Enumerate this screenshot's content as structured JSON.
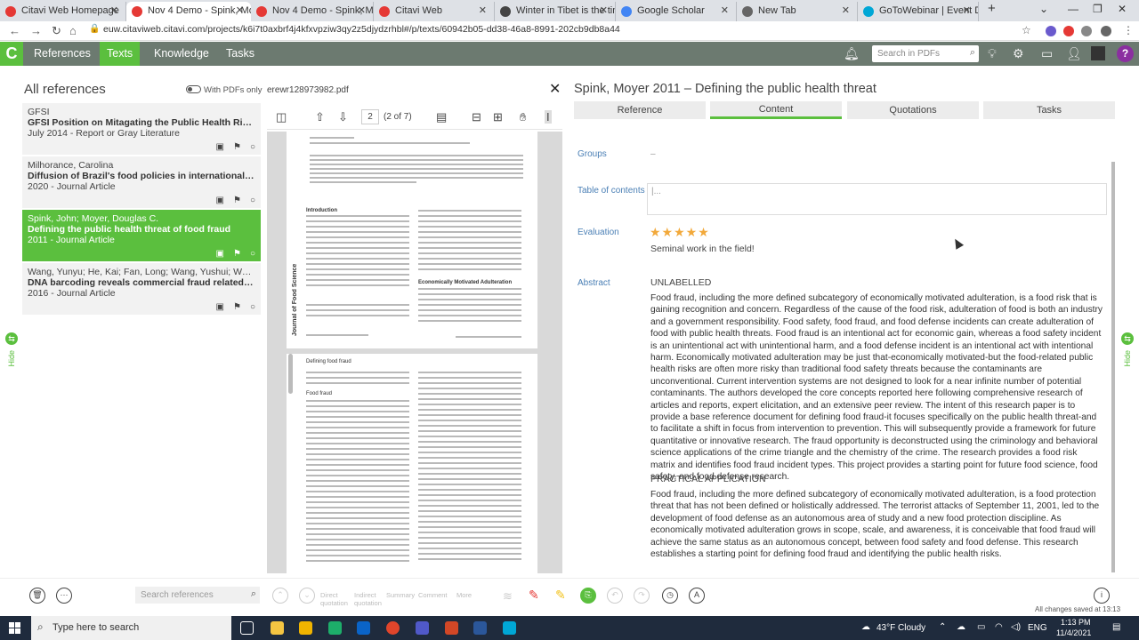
{
  "browser": {
    "tabs": [
      {
        "title": "Citavi Web Homepage",
        "color": "#e53935"
      },
      {
        "title": "Nov 4 Demo - Spink, Moyer",
        "color": "#e53935"
      },
      {
        "title": "Nov 4 Demo - Spink, Moyer",
        "color": "#e53935"
      },
      {
        "title": "Citavi Web",
        "color": "#e53935"
      },
      {
        "title": "Winter in Tibet is the time",
        "color": "#444"
      },
      {
        "title": "Google Scholar",
        "color": "#4285f4"
      },
      {
        "title": "New Tab",
        "color": "#666"
      },
      {
        "title": "GoToWebinar | Event Details",
        "color": "#00a7d6"
      }
    ],
    "url": "euw.citaviweb.citavi.com/projects/k6i7t0axbrf4j4kfxvpziw3qy2z5djydzrhbl#/p/texts/60942b05-dd38-46a8-8991-202cb9db8a44"
  },
  "app": {
    "logo": "C",
    "nav": [
      "References",
      "Texts",
      "Knowledge",
      "Tasks"
    ],
    "active_nav": "Texts",
    "pdf_search_placeholder": "Search in PDFs",
    "accent": "#5bbf3e"
  },
  "left": {
    "heading": "All references",
    "toggle_label": "With PDFs only",
    "refs": [
      {
        "author": "GFSI",
        "title": "GFSI Position on Mitagating the Public Health Risk of F...",
        "meta": "July 2014 - Report or Gray Literature"
      },
      {
        "author": "Milhorance, Carolina",
        "title": "Diffusion of Brazil's food policies in international organ...",
        "meta": "2020 - Journal Article"
      },
      {
        "author": "Spink, John; Moyer, Douglas C.",
        "title": "Defining the public health threat of food fraud",
        "meta": "2011 - Journal Article"
      },
      {
        "author": "Wang, Yunyu; He, Kai; Fan, Long; Wang, Yushui; Wu, Shifa...",
        "title": "DNA barcoding reveals commercial fraud related to ya...",
        "meta": "2016 - Journal Article"
      }
    ],
    "hide_label": "Hide"
  },
  "pdf": {
    "filename": "erewr128973982.pdf",
    "page": "2",
    "page_of": "(2 of 7)",
    "journal": "Journal of Food Science",
    "headings": [
      "Introduction",
      "Economically Motivated Adulteration",
      "Defining food fraud",
      "Food fraud"
    ]
  },
  "right": {
    "title": "Spink, Moyer 2011 – Defining the public health threat",
    "tabs": [
      "Reference",
      "Content",
      "Quotations",
      "Tasks"
    ],
    "active_tab": "Content",
    "groups_label": "Groups",
    "groups_value": "–",
    "toc_label": "Table of contents",
    "toc_value": "|...",
    "evaluation_label": "Evaluation",
    "stars": "★★★★★",
    "evaluation_text": "Seminal work in the field!",
    "abstract_label": "Abstract",
    "abstract_heading1": "UNLABELLED",
    "abstract_text1": "Food fraud, including the more defined subcategory of economically motivated adulteration, is a food risk that is gaining recognition and concern. Regardless of the cause of the food risk, adulteration of food is both an industry and a government responsibility. Food safety, food fraud, and food defense incidents can create adulteration of food with public health threats. Food fraud is an intentional act for economic gain, whereas a food safety incident is an unintentional act with unintentional harm, and a food defense incident is an intentional act with intentional harm. Economically motivated adulteration may be just that-economically motivated-but the food-related public health risks are often more risky than traditional food safety threats because the contaminants are unconventional. Current intervention systems are not designed to look for a near infinite number of potential contaminants. The authors developed the core concepts reported here following comprehensive research of articles and reports, expert elicitation, and an extensive peer review. The intent of this research paper is to provide a base reference document for defining food fraud-it focuses specifically on the public health threat-and to facilitate a shift in focus from intervention to prevention. This will subsequently provide a framework for future quantitative or innovative research. The fraud opportunity is deconstructed using the criminology and behavioral science applications of the crime triangle and the chemistry of the crime. The research provides a food risk matrix and identifies food fraud incident types. This project provides a starting point for future food science, food safety, and food defense research.",
    "abstract_heading2": "PRACTICAL APPLICATION",
    "abstract_text2": "Food fraud, including the more defined subcategory of economically motivated adulteration, is a food protection threat that has not been defined or holistically addressed. The terrorist attacks of September 11, 2001, led to the development of food defense as an autonomous area of study and a new food protection discipline. As economically motivated adulteration grows in scope, scale, and awareness, it is conceivable that food fraud will achieve the same status as an autonomous concept, between food safety and food defense. This research establishes a starting point for defining food fraud and identifying the public health risks."
  },
  "bottom": {
    "search_placeholder": "Search references",
    "faded_labels": [
      "Direct quotation",
      "Indirect quotation",
      "Summary",
      "Comment",
      "More"
    ],
    "saved": "All changes saved at 13:13"
  },
  "taskbar": {
    "search": "Type here to search",
    "weather": "43°F  Cloudy",
    "lang": "ENG",
    "time": "1:13 PM",
    "date": "11/4/2021"
  }
}
